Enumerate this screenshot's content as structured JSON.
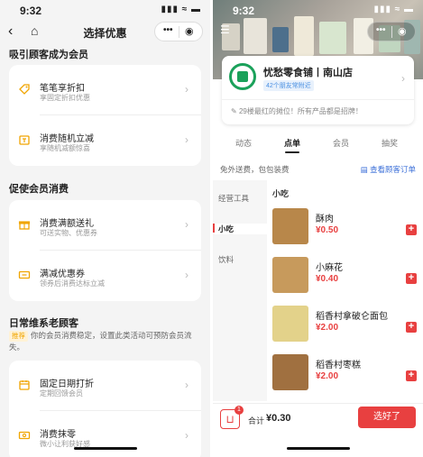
{
  "left": {
    "status": {
      "time": "9:32",
      "icons": "▮▮▮ ≈ ▬"
    },
    "nav": {
      "back": "‹",
      "home": "⌂",
      "title": "选择优惠",
      "more": "•••",
      "record": "◉"
    },
    "sections": [
      {
        "title": "吸引顾客成为会员",
        "items": [
          {
            "icon": "tag-icon",
            "title": "笔笔享折扣",
            "sub": "享固定折扣优惠"
          },
          {
            "icon": "random-discount-icon",
            "title": "消费随机立减",
            "sub": "享随机减额惊喜"
          }
        ]
      },
      {
        "title": "促使会员消费",
        "items": [
          {
            "icon": "gift-icon",
            "title": "消费满额送礼",
            "sub": "可送实物、优惠券"
          },
          {
            "icon": "coupon-icon",
            "title": "满减优惠券",
            "sub": "领券后消费达标立减"
          }
        ]
      },
      {
        "title": "日常维系老顾客",
        "tip_tag": "推荐",
        "tip_text": "你的会员消费稳定，设置此类活动可预防会员流失。",
        "items": [
          {
            "icon": "calendar-icon",
            "title": "固定日期打折",
            "sub": "定期回馈会员"
          },
          {
            "icon": "rounding-icon",
            "title": "消费抹零",
            "sub": "微小让利获好感"
          }
        ]
      }
    ],
    "chevron": "›"
  },
  "right": {
    "status": {
      "time": "9:32",
      "icons": "▮▮▮ ≈ ▬"
    },
    "nav": {
      "more": "•••",
      "record": "◉"
    },
    "shop": {
      "name": "忧愁零食铺丨南山店",
      "friends": "42个朋友常附近",
      "notice": "29楼最红的摊位！所有产品都是招牌！"
    },
    "tabs": [
      "动态",
      "点单",
      "会员",
      "抽奖"
    ],
    "active_tab": "点单",
    "shipping": "免外送费，包包装费",
    "view_orders": "查看顾客订单",
    "categories": [
      "经营工具",
      "小吃",
      "饮料"
    ],
    "active_category": "小吃",
    "product_section": "小吃",
    "products": [
      {
        "name": "酥肉",
        "price": "¥0.50",
        "color": "#b8874a"
      },
      {
        "name": "小麻花",
        "price": "¥0.40",
        "color": "#c79a5c"
      },
      {
        "name": "稻香村拿破仑面包",
        "price": "¥2.00",
        "color": "#e3d28a"
      },
      {
        "name": "稻香村枣糕",
        "price": "¥2.00",
        "color": "#a07040"
      }
    ],
    "cart_count": "1",
    "total_label": "合计",
    "total_value": "¥0.30",
    "checkout_label": "选好了"
  }
}
